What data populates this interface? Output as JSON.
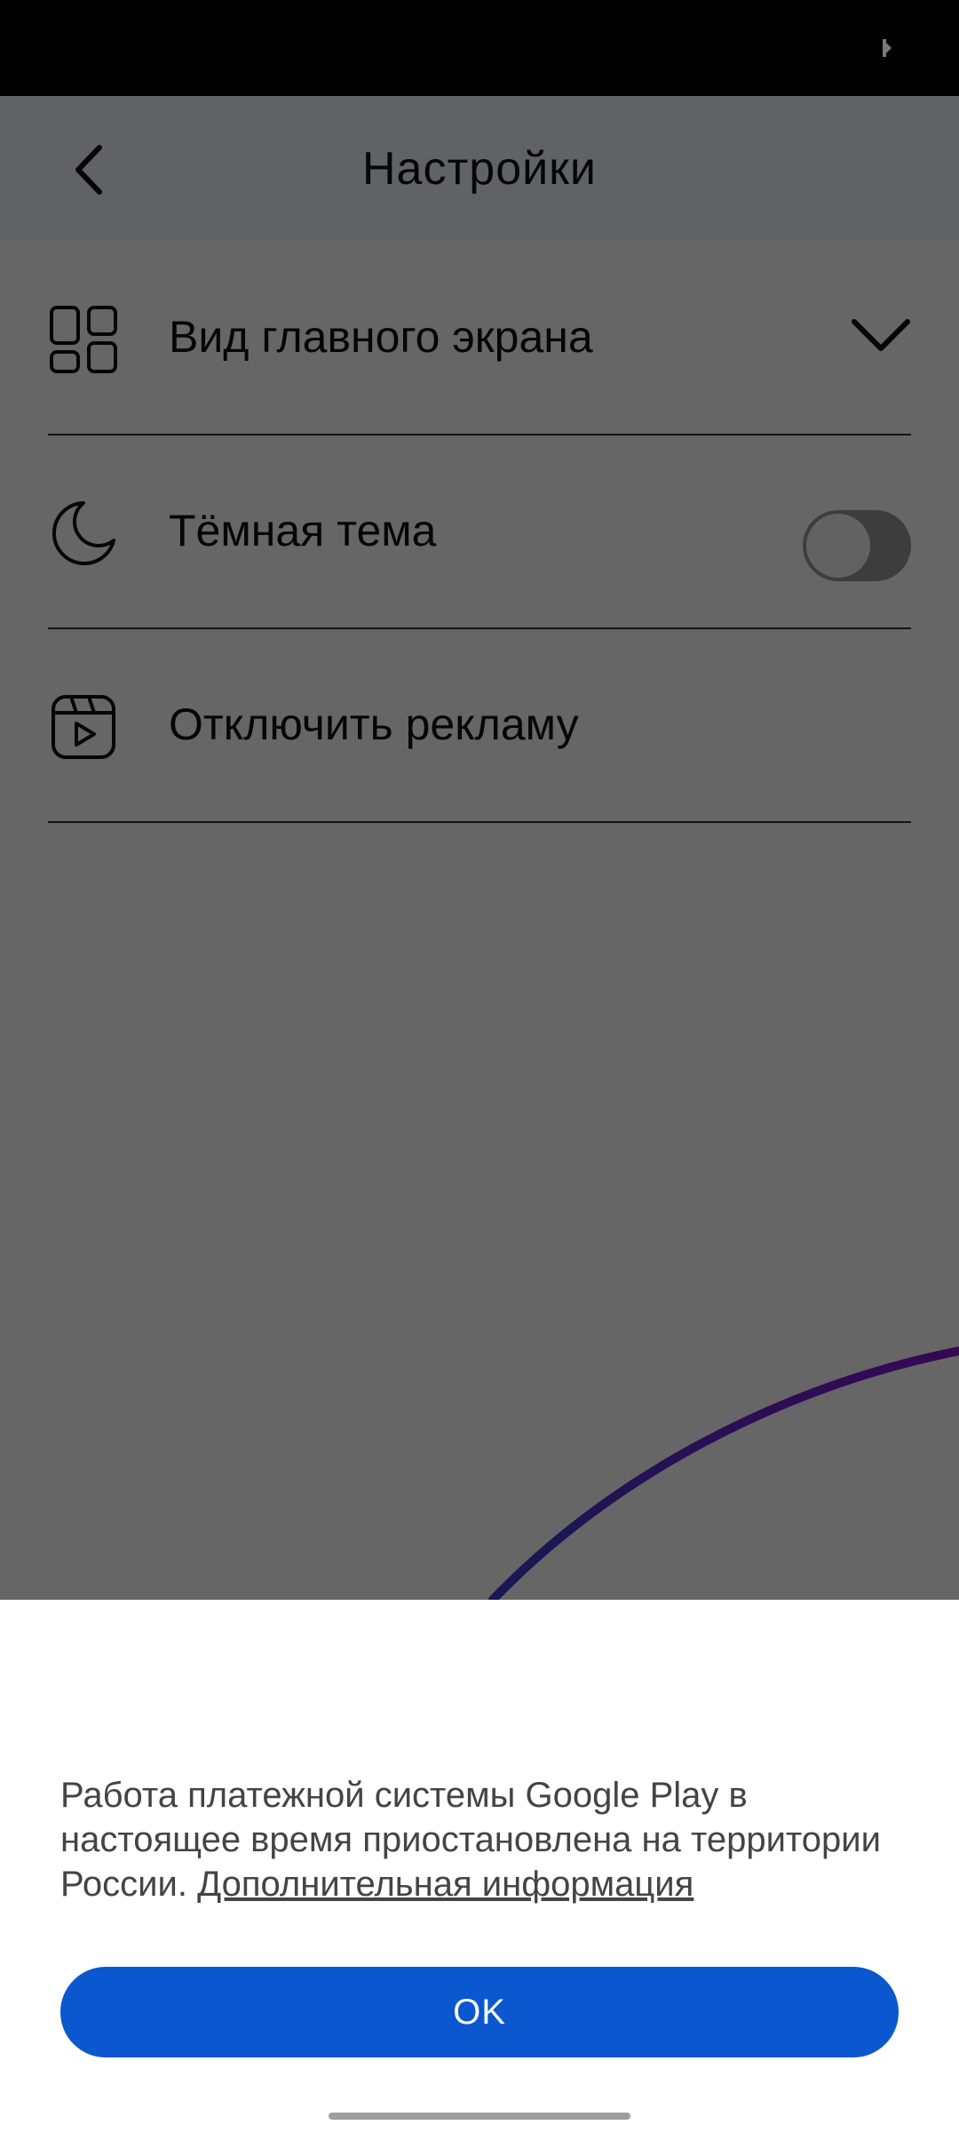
{
  "header": {
    "title": "Настройки"
  },
  "settings": {
    "items": [
      {
        "label": "Вид главного экрана",
        "icon": "grid-layout-icon",
        "control": "expand-chevron"
      },
      {
        "label": "Тёмная тема",
        "icon": "moon-icon",
        "control": "toggle",
        "toggle_on": false
      },
      {
        "label": "Отключить рекламу",
        "icon": "video-play-icon"
      }
    ]
  },
  "dialog": {
    "message": "Работа платежной системы Google Play в настоящее время приостановлена на территории России.",
    "link": "Дополнительная информация",
    "ok_label": "OK"
  },
  "colors": {
    "accent": "#0b57d0",
    "decorative_arc": "#5b1fa8",
    "scrim": "rgba(0,0,0,0.6)"
  }
}
